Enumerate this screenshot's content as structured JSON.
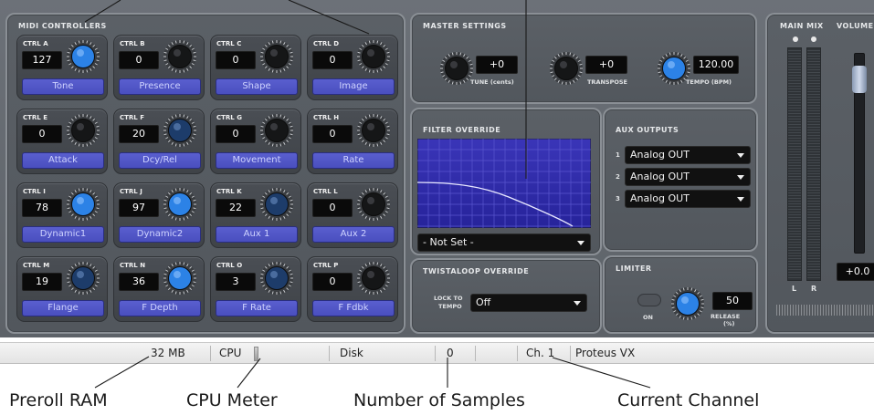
{
  "midi_controllers": {
    "title": "MIDI CONTROLLERS",
    "cells": [
      {
        "ctrl": "CTRL A",
        "value": "127",
        "name": "Tone",
        "knob": "blue"
      },
      {
        "ctrl": "CTRL B",
        "value": "0",
        "name": "Presence",
        "knob": "dark"
      },
      {
        "ctrl": "CTRL C",
        "value": "0",
        "name": "Shape",
        "knob": "dark"
      },
      {
        "ctrl": "CTRL D",
        "value": "0",
        "name": "Image",
        "knob": "dark"
      },
      {
        "ctrl": "CTRL E",
        "value": "0",
        "name": "Attack",
        "knob": "dark"
      },
      {
        "ctrl": "CTRL F",
        "value": "20",
        "name": "Dcy/Rel",
        "knob": "darkblue"
      },
      {
        "ctrl": "CTRL G",
        "value": "0",
        "name": "Movement",
        "knob": "dark"
      },
      {
        "ctrl": "CTRL H",
        "value": "0",
        "name": "Rate",
        "knob": "dark"
      },
      {
        "ctrl": "CTRL I",
        "value": "78",
        "name": "Dynamic1",
        "knob": "blue"
      },
      {
        "ctrl": "CTRL J",
        "value": "97",
        "name": "Dynamic2",
        "knob": "blue"
      },
      {
        "ctrl": "CTRL K",
        "value": "22",
        "name": "Aux 1",
        "knob": "darkblue"
      },
      {
        "ctrl": "CTRL L",
        "value": "0",
        "name": "Aux 2",
        "knob": "dark"
      },
      {
        "ctrl": "CTRL M",
        "value": "19",
        "name": "Flange",
        "knob": "darkblue"
      },
      {
        "ctrl": "CTRL N",
        "value": "36",
        "name": "F Depth",
        "knob": "blue"
      },
      {
        "ctrl": "CTRL O",
        "value": "3",
        "name": "F Rate",
        "knob": "darkblue"
      },
      {
        "ctrl": "CTRL P",
        "value": "0",
        "name": "F Fdbk",
        "knob": "dark"
      }
    ]
  },
  "master_settings": {
    "title": "MASTER SETTINGS",
    "tune": {
      "value": "+0",
      "label": "TUNE (cents)"
    },
    "transpose": {
      "value": "+0",
      "label": "TRANSPOSE"
    },
    "tempo": {
      "value": "120.00",
      "label": "TEMPO (BPM)"
    }
  },
  "filter_override": {
    "title": "FILTER OVERRIDE",
    "selected": "- Not Set -"
  },
  "aux_outputs": {
    "title": "AUX OUTPUTS",
    "outputs": [
      {
        "num": "1",
        "value": "Analog OUT"
      },
      {
        "num": "2",
        "value": "Analog OUT"
      },
      {
        "num": "3",
        "value": "Analog OUT"
      }
    ]
  },
  "twistaloop": {
    "title": "TWISTALOOP OVERRIDE",
    "lock_label_1": "LOCK TO",
    "lock_label_2": "TEMPO",
    "selected": "Off"
  },
  "limiter": {
    "title": "LIMITER",
    "on_label": "ON",
    "release_value": "50",
    "release_label": "RELEASE",
    "release_unit": "(%)"
  },
  "main_mix": {
    "title": "MAIN MIX",
    "volume_title": "VOLUME",
    "left_label": "L",
    "right_label": "R",
    "volume_value": "+0.0"
  },
  "statusbar": {
    "ram": "32 MB",
    "cpu_label": "CPU",
    "disk_label": "Disk",
    "samples": "0",
    "channel": "Ch. 1",
    "instrument": "Proteus VX"
  },
  "callouts": {
    "preroll": "Preroll RAM",
    "cpu_meter": "CPU Meter",
    "num_samples": "Number of Samples",
    "current_channel": "Current Channel"
  },
  "colors": {
    "panel_bg": "#565b61",
    "name_button": "#4e53c6",
    "knob_blue": "#2a7fe0",
    "filter_bg": "#2d2aa3",
    "statusbar_bg": "#ececec"
  }
}
